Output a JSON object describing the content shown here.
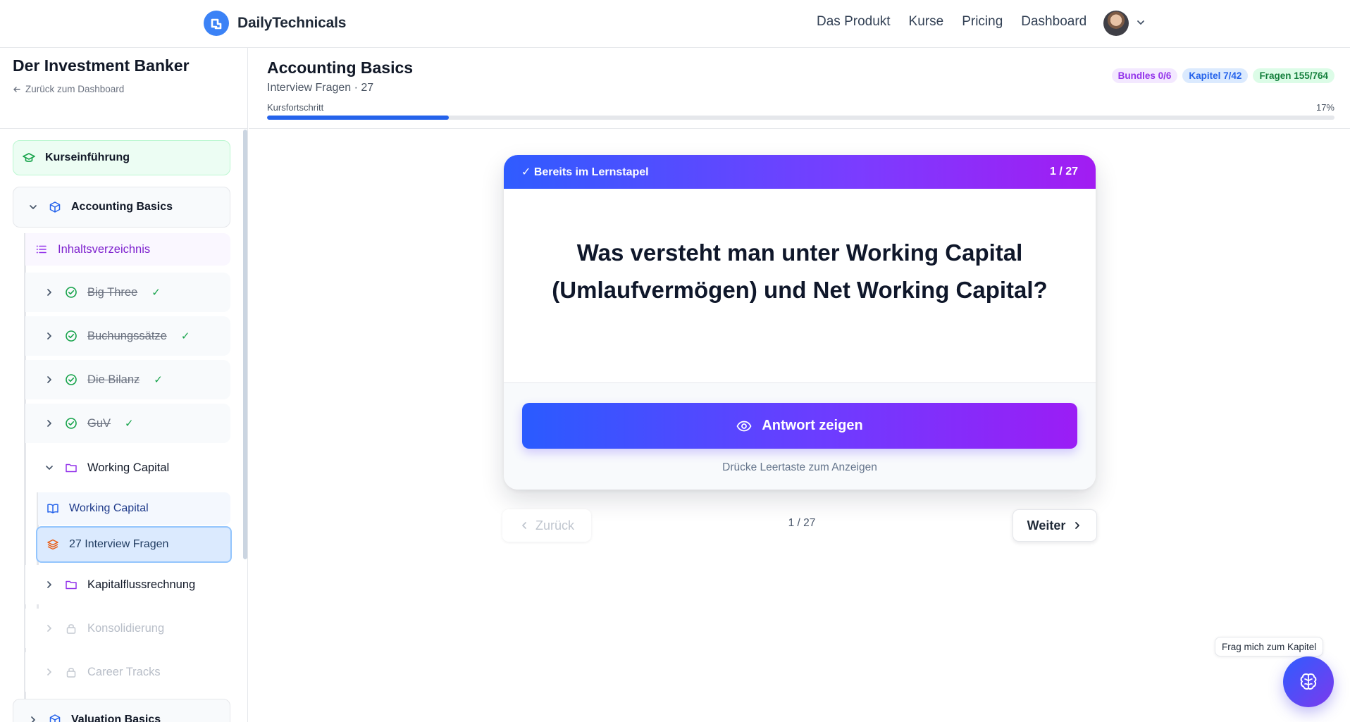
{
  "nav": {
    "brand": "DailyTechnicals",
    "links": [
      "Das Produkt",
      "Kurse",
      "Pricing",
      "Dashboard"
    ]
  },
  "sidebar": {
    "title": "Der Investment Banker",
    "back_label": "Zurück zum Dashboard",
    "intro": "Kurseinführung",
    "course": "Accounting Basics",
    "toc": "Inhaltsverzeichnis",
    "chapters_done": [
      {
        "label": "Big Three",
        "check": "✓"
      },
      {
        "label": "Buchungssätze",
        "check": "✓"
      },
      {
        "label": "Die Bilanz",
        "check": "✓"
      },
      {
        "label": "GuV",
        "check": "✓"
      }
    ],
    "chapter_open": "Working Capital",
    "chapter_open_items": [
      "Working Capital",
      "27 Interview Fragen"
    ],
    "chapter_next": "Kapitalflussrechnung",
    "chapters_locked": [
      "Konsolidierung",
      "Career Tracks"
    ],
    "next_course": "Valuation Basics"
  },
  "header": {
    "title": "Accounting Basics",
    "subtitle": "Interview Fragen · 27",
    "badges": {
      "bundles": "Bundles 0/6",
      "kapitel": "Kapitel 7/42",
      "fragen": "Fragen 155/764"
    },
    "progress_label": "Kursfortschritt",
    "progress_text": "17%",
    "progress_value": 0.17
  },
  "card": {
    "status": "✓ Bereits im Lernstapel",
    "counter": "1 / 27",
    "question": "Was versteht man unter Working Capital (Umlaufvermögen) und Net Working Capital?",
    "reveal_label": "Antwort zeigen",
    "hint": "Drücke Leertaste zum Anzeigen"
  },
  "pager": {
    "prev": "Zurück",
    "count": "1 / 27",
    "next": "Weiter"
  },
  "assistant": {
    "tooltip": "Frag mich zum Kapitel"
  },
  "colors": {
    "accent": "#2563eb",
    "purple": "#7c3aed",
    "success": "#16a34a"
  }
}
